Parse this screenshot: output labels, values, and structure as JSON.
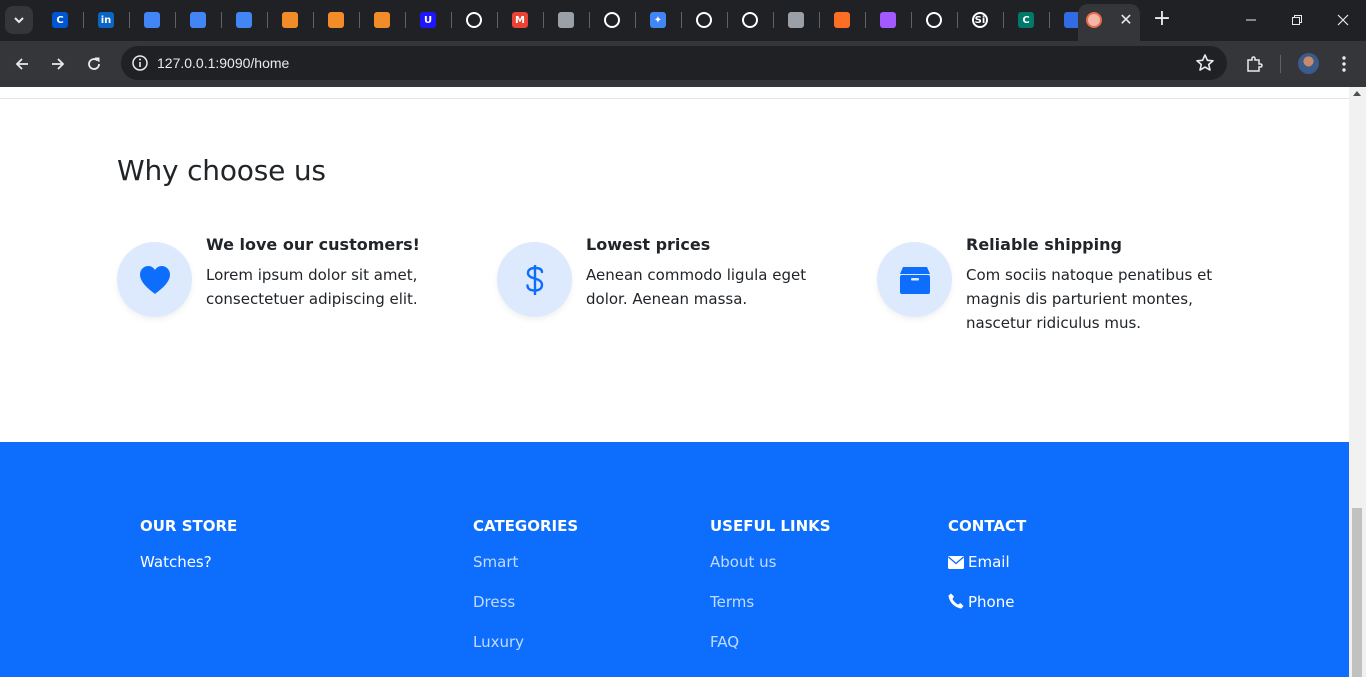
{
  "browser": {
    "url": "127.0.0.1:9090/home",
    "pinned_tabs": [
      {
        "icon": "coursera-icon",
        "glyph": "C",
        "color": "#0056d2"
      },
      {
        "icon": "linkedin-icon",
        "glyph": "in",
        "color": "#0a66c2"
      },
      {
        "icon": "google-cloud-icon",
        "glyph": "",
        "color": "#4285f4"
      },
      {
        "icon": "google-cloud-icon",
        "glyph": "",
        "color": "#4285f4"
      },
      {
        "icon": "google-cloud-icon",
        "glyph": "",
        "color": "#4285f4"
      },
      {
        "icon": "orange-square-icon",
        "glyph": "",
        "color": "#f28c28"
      },
      {
        "icon": "orange-cube-icon",
        "glyph": "",
        "color": "#f28c28"
      },
      {
        "icon": "orange-square-icon",
        "glyph": "",
        "color": "#f28c28"
      },
      {
        "icon": "udacity-icon",
        "glyph": "U",
        "color": "#2015ff"
      },
      {
        "icon": "github-icon",
        "glyph": "",
        "color": "#ffffff"
      },
      {
        "icon": "gmail-icon",
        "glyph": "M",
        "color": "#ea4335"
      },
      {
        "icon": "youtube-icon",
        "glyph": "",
        "color": "#9aa0a6"
      },
      {
        "icon": "bot-icon",
        "glyph": "",
        "color": "#ffffff"
      },
      {
        "icon": "gemini-icon",
        "glyph": "✦",
        "color": "#4285f4"
      },
      {
        "icon": "github-icon",
        "glyph": "",
        "color": "#ffffff"
      },
      {
        "icon": "github-icon",
        "glyph": "",
        "color": "#ffffff"
      },
      {
        "icon": "globe-icon",
        "glyph": "",
        "color": "#9aa0a6"
      },
      {
        "icon": "gitlab-icon",
        "glyph": "",
        "color": "#fc6d26"
      },
      {
        "icon": "figma-icon",
        "glyph": "",
        "color": "#a259ff"
      },
      {
        "icon": "github-icon",
        "glyph": "",
        "color": "#ffffff"
      },
      {
        "icon": "si-icon",
        "glyph": "Si",
        "color": "#ffffff"
      },
      {
        "icon": "c-green-icon",
        "glyph": "C",
        "color": "#00796b"
      },
      {
        "icon": "kubernetes-icon",
        "glyph": "",
        "color": "#326ce5"
      }
    ]
  },
  "why_choose_us": {
    "title": "Why choose us",
    "features": [
      {
        "icon": "heart-icon",
        "title": "We love our customers!",
        "text": "Lorem ipsum dolor sit amet, consectetuer adipiscing elit."
      },
      {
        "icon": "dollar-icon",
        "title": "Lowest prices",
        "text": "Aenean commodo ligula eget dolor. Aenean massa."
      },
      {
        "icon": "box-icon",
        "title": "Reliable shipping",
        "text": "Com sociis natoque penatibus et magnis dis parturient montes, nascetur ridiculus mus."
      }
    ]
  },
  "footer": {
    "our_store": {
      "heading": "OUR STORE",
      "links": [
        "Watches?"
      ]
    },
    "categories": {
      "heading": "CATEGORIES",
      "links": [
        "Smart",
        "Dress",
        "Luxury"
      ]
    },
    "useful_links": {
      "heading": "USEFUL LINKS",
      "links": [
        "About us",
        "Terms",
        "FAQ"
      ]
    },
    "contact": {
      "heading": "CONTACT",
      "links": [
        {
          "icon": "envelope-icon",
          "label": "Email"
        },
        {
          "icon": "phone-icon",
          "label": "Phone"
        }
      ]
    }
  },
  "colors": {
    "accent": "#0d6efd",
    "icon_bg": "#dde9fd"
  }
}
